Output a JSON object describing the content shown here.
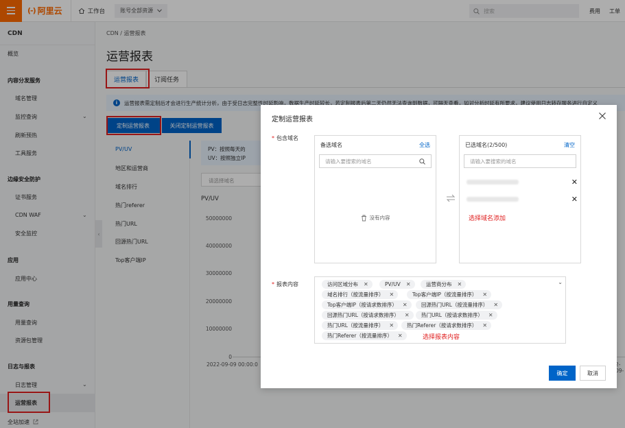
{
  "topbar": {
    "brand": "阿里云",
    "brand_mark": "(-)",
    "workbench": "工作台",
    "account_scope": "账号全部资源",
    "search_placeholder": "搜索",
    "cost": "费用",
    "ticket": "工单"
  },
  "sidebar": {
    "title": "CDN",
    "items": [
      {
        "label": "概览"
      },
      {
        "label": "内容分发服务"
      },
      {
        "label": "域名管理"
      },
      {
        "label": "监控查询"
      },
      {
        "label": "刷新预热"
      },
      {
        "label": "工具服务"
      },
      {
        "label": "边缘安全防护"
      },
      {
        "label": "证书服务"
      },
      {
        "label": "CDN WAF"
      },
      {
        "label": "安全监控"
      },
      {
        "label": "应用"
      },
      {
        "label": "应用中心"
      },
      {
        "label": "用量查询"
      },
      {
        "label": "用量查询"
      },
      {
        "label": "资源包管理"
      },
      {
        "label": "日志与报表"
      },
      {
        "label": "日志管理"
      },
      {
        "label": "运营报表"
      },
      {
        "label": "全站加速"
      }
    ]
  },
  "main": {
    "breadcrumb": "CDN  /  运营报表",
    "title": "运营报表",
    "tabs": [
      {
        "label": "运营报表"
      },
      {
        "label": "订阅任务"
      }
    ],
    "info": "运营报表需定制后才会进行生产统计分析，由于受日志完整性时延影响，数据生产时延较长，若定制报表后第二天仍然无法查询到数据，可隔天查看，如对分析时延有所要求，建议使用日志转存服务进行自定义",
    "buttons": {
      "custom": "定制运营报表",
      "close_custom": "关闭定制运营报表"
    },
    "report_menu": [
      {
        "label": "PV/UV"
      },
      {
        "label": "地区和运营商"
      },
      {
        "label": "域名排行"
      },
      {
        "label": "热门referer"
      },
      {
        "label": "热门URL"
      },
      {
        "label": "回源热门URL"
      },
      {
        "label": "Top客户端IP"
      }
    ],
    "panel_info_line1": "PV：按照每天的",
    "panel_info_line2": "UV：按照独立IP",
    "domain_select_placeholder": "请选择域名",
    "chart_title": "PV/UV",
    "y_ticks": [
      "50000000",
      "40000000",
      "30000000",
      "20000000",
      "10000000",
      "0"
    ],
    "x_tick_first": "2022-09-09 00:00:0",
    "x_tick_last": "2-09-"
  },
  "dialog": {
    "title": "定制运营报表",
    "domain_label": "包含域名",
    "available": {
      "title": "备选域名",
      "select_all": "全选",
      "search_placeholder": "请输入要搜索的域名",
      "empty": "没有内容"
    },
    "selected": {
      "title": "已选域名(2/500)",
      "clear": "清空",
      "search_placeholder": "请输入要搜索的域名",
      "note": "选择域名添加"
    },
    "report_label": "报表内容",
    "report_tags": [
      {
        "label": "访问区域分布"
      },
      {
        "label": "PV/UV"
      },
      {
        "label": "运营商分布"
      },
      {
        "label": "域名排行（按流量排序）"
      },
      {
        "label": "Top客户端IP（按流量排序）"
      },
      {
        "label": "Top客户端IP（按请求数排序）"
      },
      {
        "label": "回源热门URL（按流量排序）"
      },
      {
        "label": "回源热门URL（按请求数排序）"
      },
      {
        "label": "热门URL（按请求数排序）"
      },
      {
        "label": "热门URL（按流量排序）"
      },
      {
        "label": "热门Referer（按请求数排序）"
      },
      {
        "label": "热门Referer（按流量排序）"
      }
    ],
    "report_note": "选择报表内容",
    "ok": "确定",
    "cancel": "取消"
  },
  "colors": {
    "brand_orange": "#ff6a00",
    "primary_blue": "#0064c8",
    "highlight_red": "#e02020"
  }
}
